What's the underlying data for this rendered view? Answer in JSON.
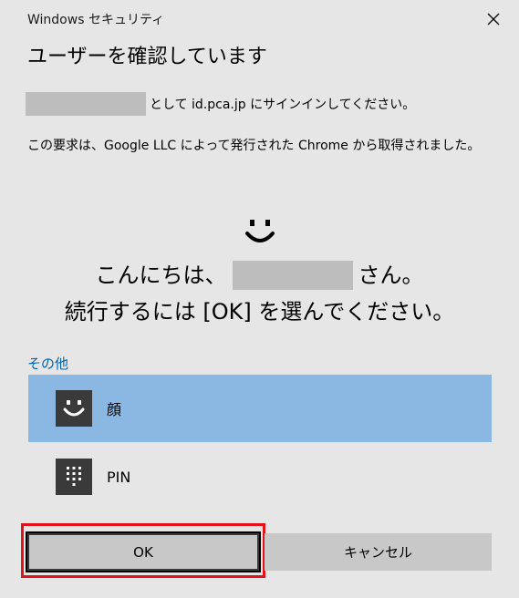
{
  "window": {
    "title": "Windows セキュリティ"
  },
  "heading": "ユーザーを確認しています",
  "signin": {
    "suffix": "として id.pca.jp にサインインしてください。"
  },
  "info": "この要求は、Google LLC によって発行された Chrome から取得されました。",
  "greeting": {
    "prefix": "こんにちは、",
    "suffix": "さん。",
    "line2": "続行するには [OK] を選んでください。"
  },
  "other_options_label": "その他",
  "options": [
    {
      "label": "顔",
      "icon": "face-smile-icon",
      "selected": true
    },
    {
      "label": "PIN",
      "icon": "pin-keypad-icon",
      "selected": false
    }
  ],
  "buttons": {
    "ok": "OK",
    "cancel": "キャンセル"
  },
  "colors": {
    "background": "#e6e6e6",
    "selected_option": "#8ab8e2",
    "link": "#0063b1",
    "highlight_border": "#e1141a"
  }
}
